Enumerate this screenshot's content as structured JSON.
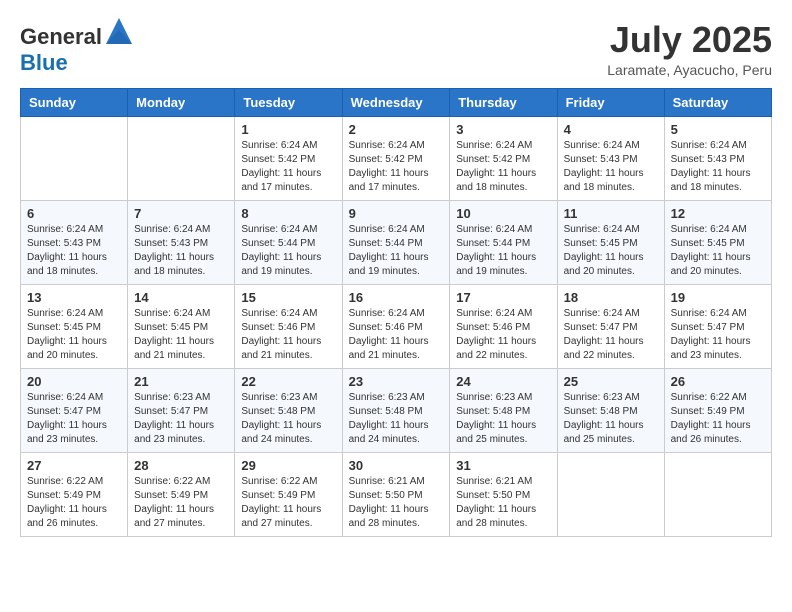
{
  "header": {
    "logo_general": "General",
    "logo_blue": "Blue",
    "month_title": "July 2025",
    "subtitle": "Laramate, Ayacucho, Peru"
  },
  "days_of_week": [
    "Sunday",
    "Monday",
    "Tuesday",
    "Wednesday",
    "Thursday",
    "Friday",
    "Saturday"
  ],
  "weeks": [
    [
      {
        "day": "",
        "info": ""
      },
      {
        "day": "",
        "info": ""
      },
      {
        "day": "1",
        "info": "Sunrise: 6:24 AM\nSunset: 5:42 PM\nDaylight: 11 hours and 17 minutes."
      },
      {
        "day": "2",
        "info": "Sunrise: 6:24 AM\nSunset: 5:42 PM\nDaylight: 11 hours and 17 minutes."
      },
      {
        "day": "3",
        "info": "Sunrise: 6:24 AM\nSunset: 5:42 PM\nDaylight: 11 hours and 18 minutes."
      },
      {
        "day": "4",
        "info": "Sunrise: 6:24 AM\nSunset: 5:43 PM\nDaylight: 11 hours and 18 minutes."
      },
      {
        "day": "5",
        "info": "Sunrise: 6:24 AM\nSunset: 5:43 PM\nDaylight: 11 hours and 18 minutes."
      }
    ],
    [
      {
        "day": "6",
        "info": "Sunrise: 6:24 AM\nSunset: 5:43 PM\nDaylight: 11 hours and 18 minutes."
      },
      {
        "day": "7",
        "info": "Sunrise: 6:24 AM\nSunset: 5:43 PM\nDaylight: 11 hours and 18 minutes."
      },
      {
        "day": "8",
        "info": "Sunrise: 6:24 AM\nSunset: 5:44 PM\nDaylight: 11 hours and 19 minutes."
      },
      {
        "day": "9",
        "info": "Sunrise: 6:24 AM\nSunset: 5:44 PM\nDaylight: 11 hours and 19 minutes."
      },
      {
        "day": "10",
        "info": "Sunrise: 6:24 AM\nSunset: 5:44 PM\nDaylight: 11 hours and 19 minutes."
      },
      {
        "day": "11",
        "info": "Sunrise: 6:24 AM\nSunset: 5:45 PM\nDaylight: 11 hours and 20 minutes."
      },
      {
        "day": "12",
        "info": "Sunrise: 6:24 AM\nSunset: 5:45 PM\nDaylight: 11 hours and 20 minutes."
      }
    ],
    [
      {
        "day": "13",
        "info": "Sunrise: 6:24 AM\nSunset: 5:45 PM\nDaylight: 11 hours and 20 minutes."
      },
      {
        "day": "14",
        "info": "Sunrise: 6:24 AM\nSunset: 5:45 PM\nDaylight: 11 hours and 21 minutes."
      },
      {
        "day": "15",
        "info": "Sunrise: 6:24 AM\nSunset: 5:46 PM\nDaylight: 11 hours and 21 minutes."
      },
      {
        "day": "16",
        "info": "Sunrise: 6:24 AM\nSunset: 5:46 PM\nDaylight: 11 hours and 21 minutes."
      },
      {
        "day": "17",
        "info": "Sunrise: 6:24 AM\nSunset: 5:46 PM\nDaylight: 11 hours and 22 minutes."
      },
      {
        "day": "18",
        "info": "Sunrise: 6:24 AM\nSunset: 5:47 PM\nDaylight: 11 hours and 22 minutes."
      },
      {
        "day": "19",
        "info": "Sunrise: 6:24 AM\nSunset: 5:47 PM\nDaylight: 11 hours and 23 minutes."
      }
    ],
    [
      {
        "day": "20",
        "info": "Sunrise: 6:24 AM\nSunset: 5:47 PM\nDaylight: 11 hours and 23 minutes."
      },
      {
        "day": "21",
        "info": "Sunrise: 6:23 AM\nSunset: 5:47 PM\nDaylight: 11 hours and 23 minutes."
      },
      {
        "day": "22",
        "info": "Sunrise: 6:23 AM\nSunset: 5:48 PM\nDaylight: 11 hours and 24 minutes."
      },
      {
        "day": "23",
        "info": "Sunrise: 6:23 AM\nSunset: 5:48 PM\nDaylight: 11 hours and 24 minutes."
      },
      {
        "day": "24",
        "info": "Sunrise: 6:23 AM\nSunset: 5:48 PM\nDaylight: 11 hours and 25 minutes."
      },
      {
        "day": "25",
        "info": "Sunrise: 6:23 AM\nSunset: 5:48 PM\nDaylight: 11 hours and 25 minutes."
      },
      {
        "day": "26",
        "info": "Sunrise: 6:22 AM\nSunset: 5:49 PM\nDaylight: 11 hours and 26 minutes."
      }
    ],
    [
      {
        "day": "27",
        "info": "Sunrise: 6:22 AM\nSunset: 5:49 PM\nDaylight: 11 hours and 26 minutes."
      },
      {
        "day": "28",
        "info": "Sunrise: 6:22 AM\nSunset: 5:49 PM\nDaylight: 11 hours and 27 minutes."
      },
      {
        "day": "29",
        "info": "Sunrise: 6:22 AM\nSunset: 5:49 PM\nDaylight: 11 hours and 27 minutes."
      },
      {
        "day": "30",
        "info": "Sunrise: 6:21 AM\nSunset: 5:50 PM\nDaylight: 11 hours and 28 minutes."
      },
      {
        "day": "31",
        "info": "Sunrise: 6:21 AM\nSunset: 5:50 PM\nDaylight: 11 hours and 28 minutes."
      },
      {
        "day": "",
        "info": ""
      },
      {
        "day": "",
        "info": ""
      }
    ]
  ]
}
